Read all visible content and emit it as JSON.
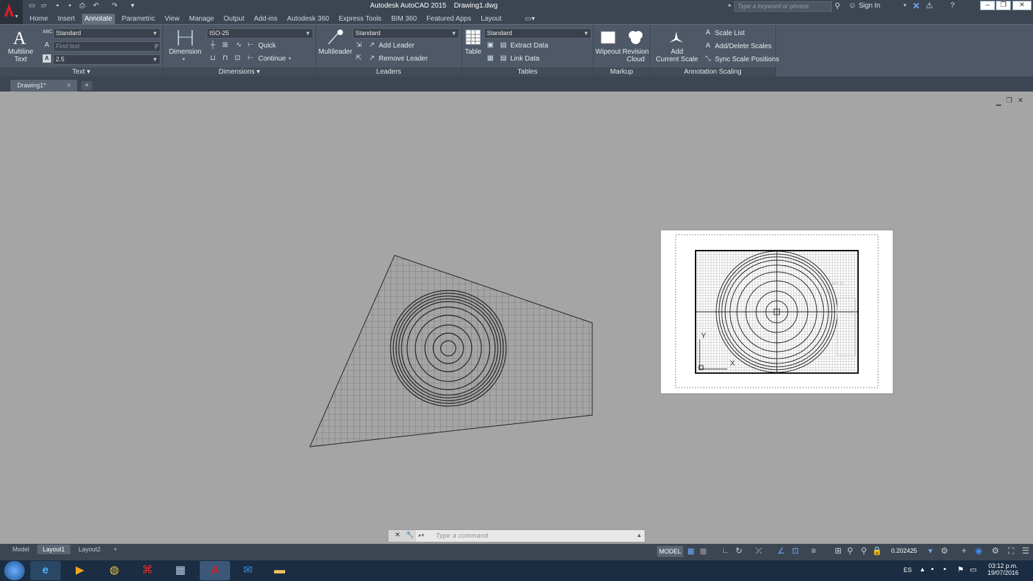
{
  "app": {
    "title": "Autodesk AutoCAD 2015",
    "file": "Drawing1.dwg",
    "search_placeholder": "Type a keyword or phrase",
    "sign_in": "Sign In"
  },
  "ribbon_tabs": [
    "Home",
    "Insert",
    "Annotate",
    "Parametric",
    "View",
    "Manage",
    "Output",
    "Add-ins",
    "Autodesk 360",
    "Express Tools",
    "BIM 360",
    "Featured Apps",
    "Layout"
  ],
  "active_tab": "Annotate",
  "panels": {
    "text": {
      "title": "Text",
      "big_button": "Multiline\nText",
      "style": "Standard",
      "find_placeholder": "Find text",
      "height": "2.5"
    },
    "dimensions": {
      "title": "Dimensions",
      "big_button": "Dimension",
      "style": "ISO-25",
      "quick": "Quick",
      "continue": "Continue"
    },
    "leaders": {
      "title": "Leaders",
      "big_button": "Multileader",
      "style": "Standard",
      "add_leader": "Add Leader",
      "remove_leader": "Remove Leader"
    },
    "tables": {
      "title": "Tables",
      "big_button": "Table",
      "style": "Standard",
      "extract": "Extract Data",
      "link": "Link Data"
    },
    "markup": {
      "title": "Markup",
      "wipeout": "Wipeout",
      "revision": "Revision\nCloud"
    },
    "annotation_scaling": {
      "title": "Annotation Scaling",
      "add_scale": "Add\nCurrent Scale",
      "scale_list": "Scale List",
      "add_delete": "Add/Delete Scales",
      "sync": "Sync Scale Positions"
    }
  },
  "doc_tab": "Drawing1*",
  "command": {
    "placeholder": "Type a command"
  },
  "layout_tabs": [
    "Model",
    "Layout1",
    "Layout2"
  ],
  "active_layout": "Layout1",
  "status": {
    "space": "MODEL",
    "scale": "0.202425"
  },
  "viewport": {
    "ucs_y": "Y",
    "ucs_x": "X",
    "wcs": "WCS"
  },
  "taskbar": {
    "lang": "ES",
    "time": "03:12 p.m.",
    "date": "19/07/2016"
  }
}
